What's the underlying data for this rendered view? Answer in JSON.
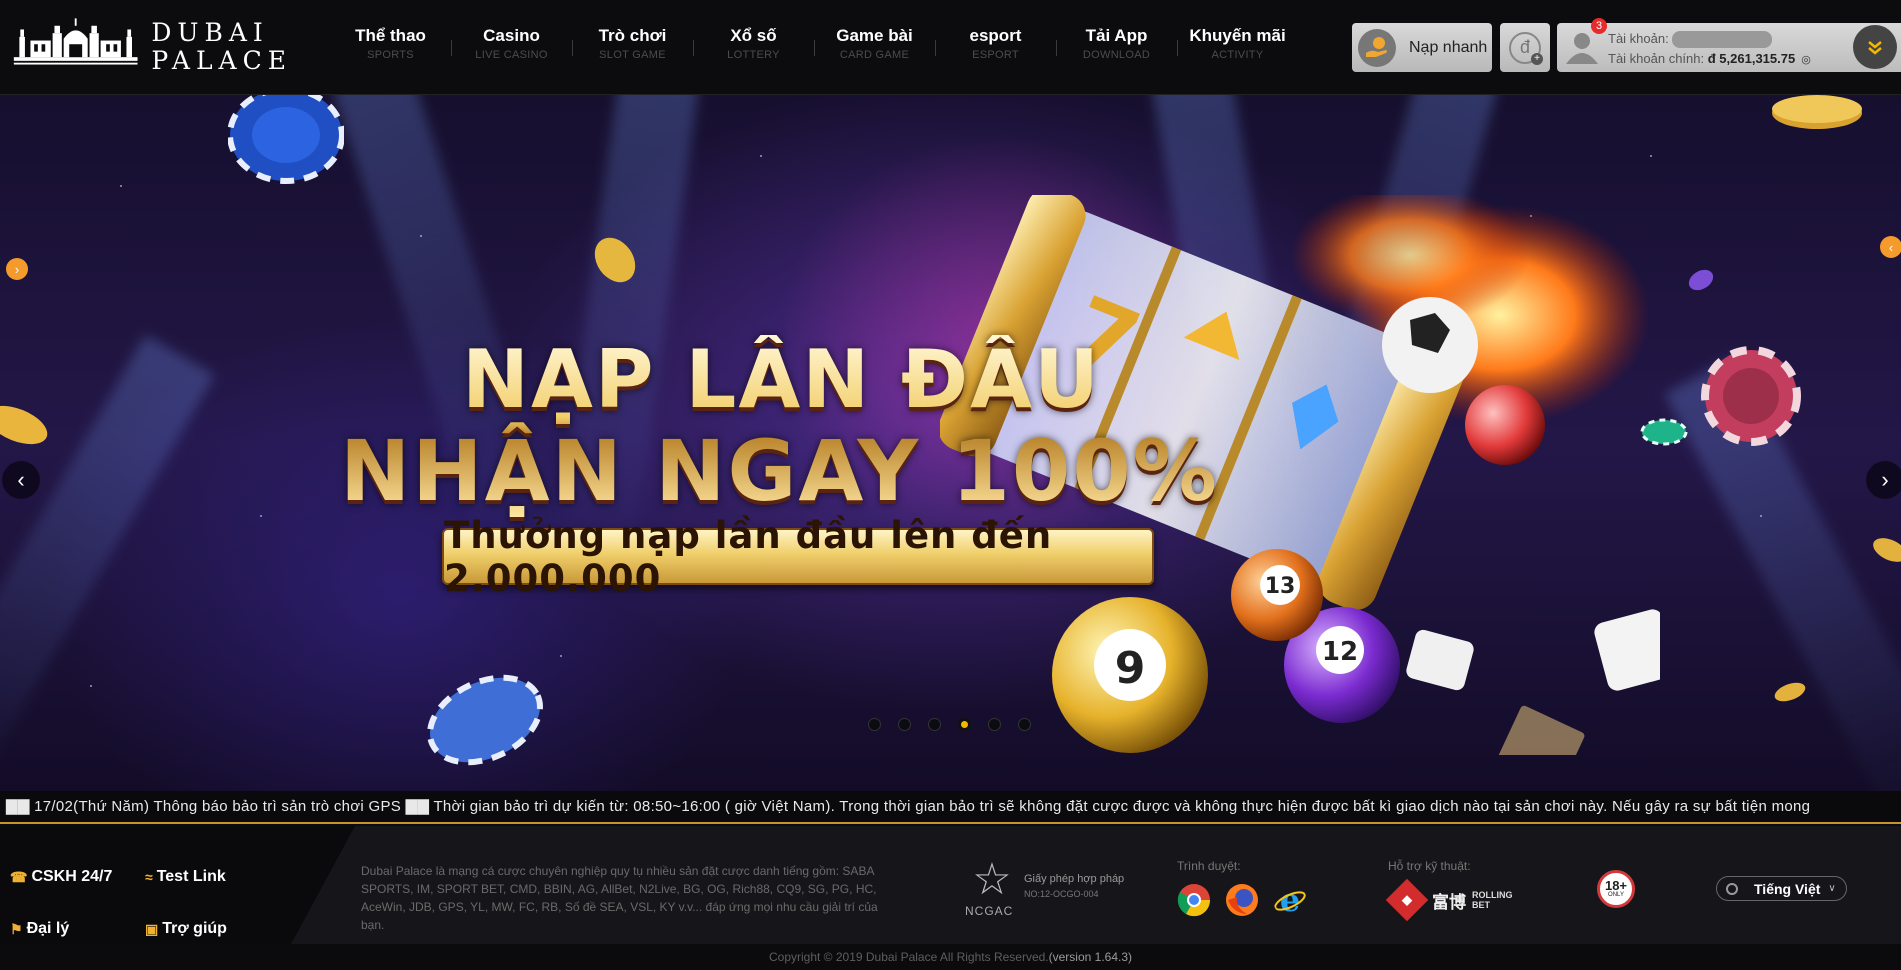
{
  "brand": {
    "line1": "DUBAI",
    "line2": "PALACE"
  },
  "nav": [
    {
      "label": "Thể thao",
      "sub": "SPORTS"
    },
    {
      "label": "Casino",
      "sub": "LIVE CASINO"
    },
    {
      "label": "Trò chơi",
      "sub": "SLOT GAME"
    },
    {
      "label": "Xổ số",
      "sub": "LOTTERY"
    },
    {
      "label": "Game bài",
      "sub": "CARD GAME"
    },
    {
      "label": "esport",
      "sub": "ESPORT"
    },
    {
      "label": "Tải App",
      "sub": "DOWNLOAD"
    },
    {
      "label": "Khuyến mãi",
      "sub": "ACTIVITY"
    }
  ],
  "header": {
    "quick_deposit": "Nạp nhanh",
    "currency_symbol": "đ",
    "account_label": "Tài khoản:",
    "balance_label": "Tài khoản chính:",
    "balance_value": "đ 5,261,315.75",
    "notification_count": "3"
  },
  "banner": {
    "headline_1": "NẠP LẦN ĐẦU",
    "headline_2": "NHẬN NGAY 100%",
    "subline": "Thưởng nạp lần đầu lên đến 2.000.000",
    "slide_count": 6,
    "active_slide": 4,
    "ball_9": "9",
    "ball_12": "12",
    "ball_13": "13"
  },
  "ticker": "▇▇ 17/02(Thứ Năm) Thông báo bảo trì sản trò chơi GPS ▇▇ Thời gian bảo trì dự kiến từ: 08:50~16:00 ( giờ Việt Nam). Trong thời gian bảo trì sẽ không đặt cược được và không thực hiện được bất kì giao dịch nào tại sản chơi này.  Nếu gây ra sự bất tiện mong",
  "footer": {
    "support": "CSKH 24/7",
    "test_link": "Test Link",
    "agent": "Đại lý",
    "help": "Trợ giúp",
    "about": "Dubai Palace là mạng cá cược chuyên nghiệp quy tụ nhiều sản đặt cược danh tiếng gồm: SABA SPORTS, IM, SPORT BET, CMD, BBIN, AG, AllBet, N2Live, BG, OG, Rich88, CQ9, SG, PG, HC, AceWin, JDB, GPS, YL, MW, FC, RB, Số đề SEA, VSL, KY v.v... đáp ứng mọi nhu cầu giải trí của bạn.",
    "license_org": "NCGAC",
    "license_title": "Giấy phép hợp pháp",
    "license_no": "NO:12-OCGO-004",
    "browsers_label": "Trình duyệt:",
    "tech_support_label": "Hỗ trợ kỹ thuật:",
    "tech_partner_cn": "富博",
    "tech_partner_en_1": "ROLLING",
    "tech_partner_en_2": "BET",
    "age_limit": "18+",
    "age_note": "ONLY",
    "language": "Tiếng Việt",
    "copyright": "Copyright © 2019 Dubai Palace All Rights Reserved.",
    "version": "(version 1.64.3)"
  },
  "colors": {
    "accent": "#f4b800",
    "ticker_line": "#c8932d",
    "header_bg": "#0c0c0f"
  }
}
